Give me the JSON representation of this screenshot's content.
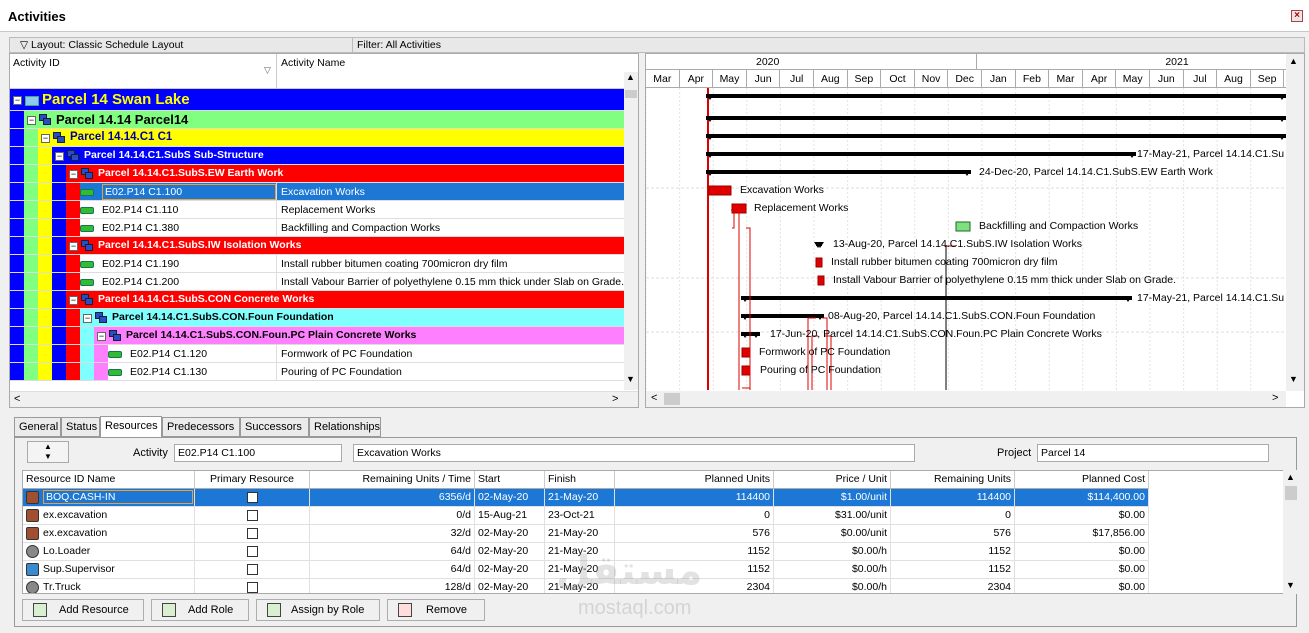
{
  "window": {
    "title": "Activities"
  },
  "toolbar": {
    "layout": "Layout: Classic Schedule Layout",
    "filter": "Filter: All Activities"
  },
  "grid": {
    "columns": [
      "Activity ID",
      "Activity Name"
    ],
    "rows": [
      {
        "kind": "wbs",
        "level": 0,
        "text": "Parcel 14  Swan Lake",
        "color": "#0000ff",
        "fg": "#ffff00"
      },
      {
        "kind": "wbs",
        "level": 1,
        "text": "Parcel 14.14  Parcel14",
        "color": "#80ff80",
        "fg": "#000000"
      },
      {
        "kind": "wbs",
        "level": 2,
        "text": "Parcel 14.14.C1  C1",
        "color": "#ffff00",
        "fg": "#0000a0"
      },
      {
        "kind": "wbs",
        "level": 3,
        "text": "Parcel 14.14.C1.SubS  Sub-Structure",
        "color": "#0000ff",
        "fg": "#ffffff"
      },
      {
        "kind": "wbs",
        "level": 4,
        "text": "Parcel 14.14.C1.SubS.EW  Earth Work",
        "color": "#ff0000",
        "fg": "#ffffff"
      },
      {
        "kind": "act",
        "level": 5,
        "id": "E02.P14 C1.100",
        "name": "Excavation Works",
        "selected": true
      },
      {
        "kind": "act",
        "level": 5,
        "id": "E02.P14 C1.110",
        "name": "Replacement Works"
      },
      {
        "kind": "act",
        "level": 5,
        "id": "E02.P14 C1.380",
        "name": "Backfilling and Compaction Works"
      },
      {
        "kind": "wbs",
        "level": 4,
        "text": "Parcel 14.14.C1.SubS.IW  Isolation Works",
        "color": "#ff0000",
        "fg": "#ffffff"
      },
      {
        "kind": "act",
        "level": 5,
        "id": "E02.P14 C1.190",
        "name": "Install rubber bitumen coating 700micron dry film"
      },
      {
        "kind": "act",
        "level": 5,
        "id": "E02.P14 C1.200",
        "name": "Install Vabour Barrier of polyethylene 0.15 mm thick under Slab on Grade."
      },
      {
        "kind": "wbs",
        "level": 4,
        "text": "Parcel 14.14.C1.SubS.CON  Concrete Works",
        "color": "#ff0000",
        "fg": "#ffffff"
      },
      {
        "kind": "wbs",
        "level": 5,
        "text": "Parcel 14.14.C1.SubS.CON.Foun  Foundation",
        "color": "#80ffff",
        "fg": "#000000"
      },
      {
        "kind": "wbs",
        "level": 6,
        "text": "Parcel 14.14.C1.SubS.CON.Foun.PC  Plain Concrete Works",
        "color": "#ff80ff",
        "fg": "#000000"
      },
      {
        "kind": "act",
        "level": 7,
        "id": "E02.P14 C1.120",
        "name": "Formwork of PC Foundation"
      },
      {
        "kind": "act",
        "level": 7,
        "id": "E02.P14 C1.130",
        "name": "Pouring of PC Foundation"
      }
    ]
  },
  "gantt": {
    "years": [
      "2020",
      "2021"
    ],
    "months": [
      "Mar",
      "Apr",
      "May",
      "Jun",
      "Jul",
      "Aug",
      "Sep",
      "Oct",
      "Nov",
      "Dec",
      "Jan",
      "Feb",
      "Mar",
      "Apr",
      "May",
      "Jun",
      "Jul",
      "Aug",
      "Sep"
    ],
    "labels": [
      "17-May-21, Parcel 14.14.C1.Su",
      "24-Dec-20, Parcel 14.14.C1.SubS.EW  Earth Work",
      "Excavation Works",
      "Replacement Works",
      "Backfilling and Compaction Works",
      "13-Aug-20, Parcel 14.14.C1.SubS.IW  Isolation Works",
      "Install rubber bitumen coating 700micron dry film",
      "Install Vabour Barrier of polyethylene 0.15 mm thick under Slab on Grade.",
      "17-May-21, Parcel 14.14.C1.Su",
      "08-Aug-20, Parcel 14.14.C1.SubS.CON.Foun  Foundation",
      "17-Jun-20, Parcel 14.14.C1.SubS.CON.Foun.PC  Plain Concrete Works",
      "Formwork of PC Foundation",
      "Pouring of PC Foundation"
    ]
  },
  "tabs": [
    "General",
    "Status",
    "Resources",
    "Predecessors",
    "Successors",
    "Relationships"
  ],
  "selected_tab": "Resources",
  "details": {
    "activity_label": "Activity",
    "activity_id": "E02.P14 C1.100",
    "activity_name": "Excavation Works",
    "project_label": "Project",
    "project": "Parcel 14"
  },
  "resources": {
    "columns": [
      "Resource ID Name",
      "Primary Resource",
      "Remaining Units / Time",
      "Start",
      "Finish",
      "Planned Units",
      "Price / Unit",
      "Remaining Units",
      "Planned Cost"
    ],
    "rows": [
      {
        "name": "BOQ.CASH-IN",
        "rut": "6356/d",
        "start": "02-May-20",
        "finish": "21-May-20",
        "pu": "114400",
        "price": "$1.00/unit",
        "ru": "114400",
        "cost": "$114,400.00",
        "icon": "material",
        "selected": true
      },
      {
        "name": "ex.excavation",
        "rut": "0/d",
        "start": "15-Aug-21",
        "finish": "23-Oct-21",
        "pu": "0",
        "price": "$31.00/unit",
        "ru": "0",
        "cost": "$0.00",
        "icon": "material"
      },
      {
        "name": "ex.excavation",
        "rut": "32/d",
        "start": "02-May-20",
        "finish": "21-May-20",
        "pu": "576",
        "price": "$0.00/unit",
        "ru": "576",
        "cost": "$17,856.00",
        "icon": "material"
      },
      {
        "name": "Lo.Loader",
        "rut": "64/d",
        "start": "02-May-20",
        "finish": "21-May-20",
        "pu": "1152",
        "price": "$0.00/h",
        "ru": "1152",
        "cost": "$0.00",
        "icon": "equipment"
      },
      {
        "name": "Sup.Supervisor",
        "rut": "64/d",
        "start": "02-May-20",
        "finish": "21-May-20",
        "pu": "1152",
        "price": "$0.00/h",
        "ru": "1152",
        "cost": "$0.00",
        "icon": "labor"
      },
      {
        "name": "Tr.Truck",
        "rut": "128/d",
        "start": "02-May-20",
        "finish": "21-May-20",
        "pu": "2304",
        "price": "$0.00/h",
        "ru": "2304",
        "cost": "$0.00",
        "icon": "equipment"
      }
    ]
  },
  "buttons": {
    "add_resource": "Add Resource",
    "add_role": "Add Role",
    "assign_by_role": "Assign by Role",
    "remove": "Remove"
  },
  "watermark": {
    "arabic": "مستقل",
    "latin": "mostaql.com"
  }
}
